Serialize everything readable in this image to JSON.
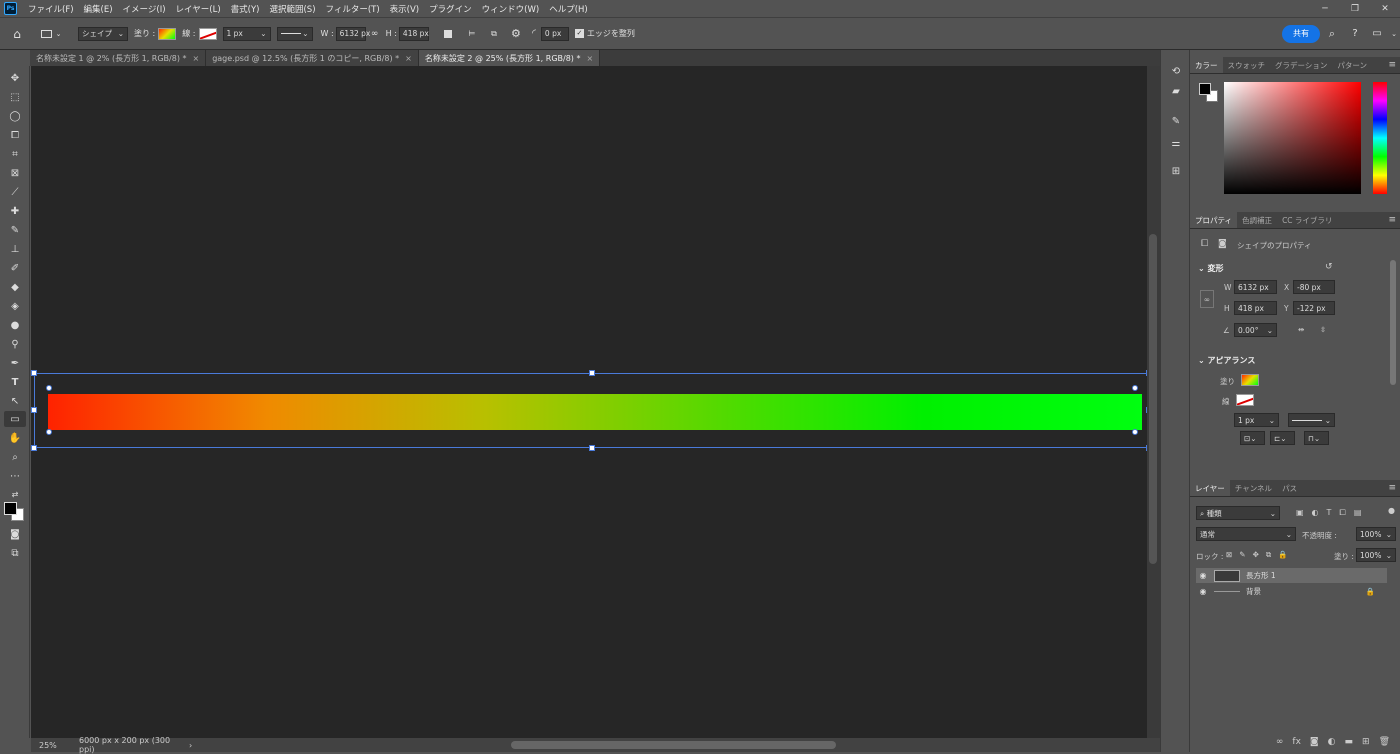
{
  "app": {
    "logo": "Ps"
  },
  "menu": [
    "ファイル(F)",
    "編集(E)",
    "イメージ(I)",
    "レイヤー(L)",
    "書式(Y)",
    "選択範囲(S)",
    "フィルター(T)",
    "表示(V)",
    "プラグイン",
    "ウィンドウ(W)",
    "ヘルプ(H)"
  ],
  "window_controls": {
    "minimize": "─",
    "restore": "❐",
    "close": "✕"
  },
  "options": {
    "mode": "シェイプ",
    "fill_label": "塗り :",
    "stroke_label": "線 :",
    "stroke_width": "1 px",
    "w_label": "W :",
    "w_value": "6132 px",
    "h_label": "H :",
    "h_value": "418 px",
    "radius_value": "0 px",
    "align_edges": "エッジを整列",
    "share": "共有"
  },
  "tabs": [
    {
      "label": "名称未設定 1 @ 2% (長方形 1, RGB/8) *",
      "active": false
    },
    {
      "label": "gage.psd @ 12.5% (長方形 1 のコピー, RGB/8) *",
      "active": false
    },
    {
      "label": "名称未設定 2 @ 25% (長方形 1, RGB/8) *",
      "active": true
    }
  ],
  "status": {
    "zoom": "25%",
    "doc_info": "6000 px x 200 px (300 ppi)"
  },
  "color_panel": {
    "tabs": [
      "カラー",
      "スウォッチ",
      "グラデーション",
      "パターン"
    ],
    "hue_color": "#ff0000"
  },
  "properties_panel": {
    "tabs": [
      "プロパティ",
      "色調補正",
      "CC ライブラリ"
    ],
    "title": "シェイプのプロパティ",
    "transform_title": "変形",
    "w_label": "W",
    "w": "6132 px",
    "x_label": "X",
    "x": "-80 px",
    "h_label": "H",
    "h": "418 px",
    "y_label": "Y",
    "y": "-122 px",
    "angle": "0.00°",
    "appearance_title": "アピアランス",
    "fill_label": "塗り",
    "stroke_label": "線",
    "stroke_width": "1 px"
  },
  "layers_panel": {
    "tabs": [
      "レイヤー",
      "チャンネル",
      "パス"
    ],
    "filter": "種類",
    "blend": "通常",
    "opacity_label": "不透明度 :",
    "opacity": "100%",
    "lock_label": "ロック :",
    "fill_label": "塗り :",
    "fill": "100%",
    "layers": [
      {
        "name": "長方形 1",
        "selected": true,
        "locked": false
      },
      {
        "name": "背景",
        "selected": false,
        "locked": true
      }
    ]
  },
  "gradient": {
    "stops": [
      "#ff2200",
      "#f08a00",
      "#b8c000",
      "#5ad800",
      "#00f000",
      "#00ff10"
    ]
  }
}
